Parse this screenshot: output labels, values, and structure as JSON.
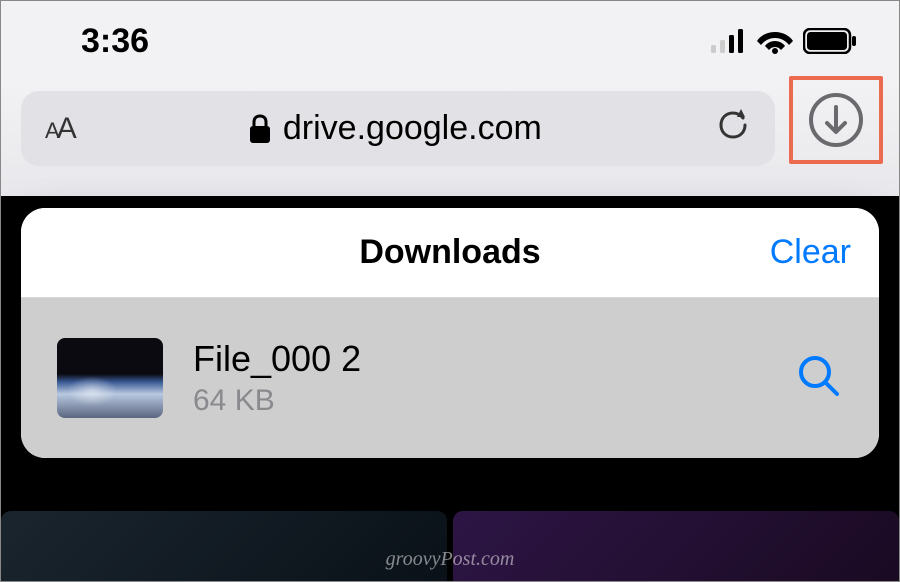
{
  "status_bar": {
    "time": "3:36"
  },
  "toolbar": {
    "url": "drive.google.com"
  },
  "downloads_popover": {
    "title": "Downloads",
    "clear_label": "Clear",
    "items": [
      {
        "name": "File_000 2",
        "size": "64 KB"
      }
    ]
  },
  "watermark": "groovyPost.com"
}
